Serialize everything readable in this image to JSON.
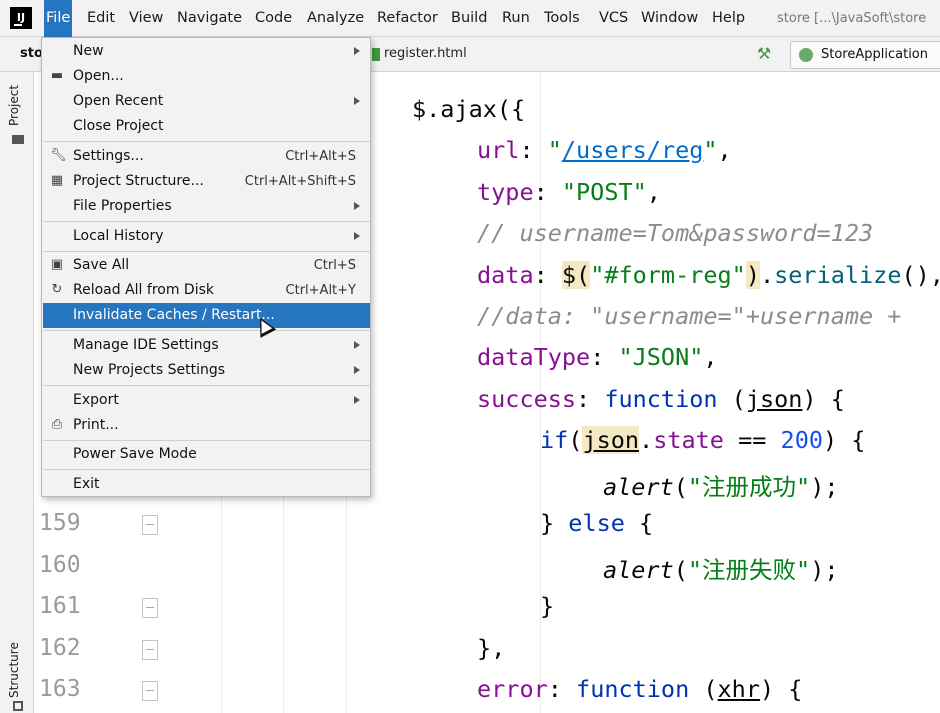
{
  "menubar": {
    "app_icon_text": "IJ",
    "items": [
      {
        "name": "file",
        "label": "File"
      },
      {
        "name": "edit",
        "label": "Edit"
      },
      {
        "name": "view",
        "label": "View"
      },
      {
        "name": "navigate",
        "label": "Navigate"
      },
      {
        "name": "code",
        "label": "Code"
      },
      {
        "name": "analyze",
        "label": "Analyze"
      },
      {
        "name": "refactor",
        "label": "Refactor"
      },
      {
        "name": "build",
        "label": "Build"
      },
      {
        "name": "run",
        "label": "Run"
      },
      {
        "name": "tools",
        "label": "Tools"
      },
      {
        "name": "vcs",
        "label": "VCS"
      },
      {
        "name": "window",
        "label": "Window"
      },
      {
        "name": "help",
        "label": "Help"
      }
    ],
    "project_path": "store [...\\JavaSoft\\store"
  },
  "tabbar": {
    "nav_project": "sto",
    "active_tab": "register.html",
    "run_config": "StoreApplication"
  },
  "toolstrip": {
    "project_label": "Project",
    "structure_label": "Structure"
  },
  "editor": {
    "line_numbers": [
      "159",
      "160",
      "161",
      "162",
      "163"
    ]
  },
  "file_menu": {
    "items": [
      {
        "label": "New",
        "submenu": true,
        "icon": ""
      },
      {
        "label": "Open...",
        "icon": "folder-icon"
      },
      {
        "label": "Open Recent",
        "submenu": true
      },
      {
        "label": "Close Project"
      },
      {
        "label": "Settings...",
        "shortcut": "Ctrl+Alt+S",
        "icon": "wrench-icon"
      },
      {
        "label": "Project Structure...",
        "shortcut": "Ctrl+Alt+Shift+S",
        "icon": "project-structure-icon"
      },
      {
        "label": "File Properties",
        "submenu": true
      },
      {
        "label": "Local History",
        "submenu": true
      },
      {
        "label": "Save All",
        "shortcut": "Ctrl+S",
        "icon": "floppy-disk-icon"
      },
      {
        "label": "Reload All from Disk",
        "shortcut": "Ctrl+Alt+Y",
        "icon": "reload-icon"
      },
      {
        "label": "Invalidate Caches / Restart...",
        "active": true
      },
      {
        "label": "Manage IDE Settings",
        "submenu": true
      },
      {
        "label": "New Projects Settings",
        "submenu": true
      },
      {
        "label": "Export",
        "submenu": true
      },
      {
        "label": "Print...",
        "icon": "printer-icon"
      },
      {
        "label": "Power Save Mode"
      },
      {
        "label": "Exit"
      }
    ]
  },
  "colors": {
    "menu_highlight": "#2675bf",
    "keyword": "#0033b3",
    "property": "#871094",
    "string": "#067d17",
    "comment": "#8c8c8c",
    "number": "#1750eb"
  }
}
